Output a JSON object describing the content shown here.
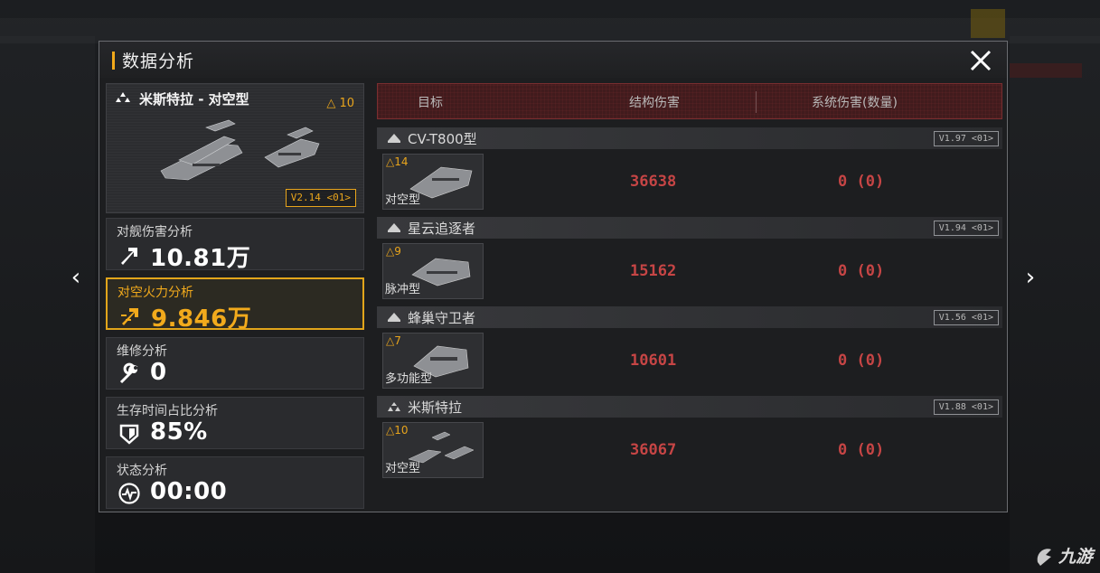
{
  "dialog": {
    "title": "数据分析"
  },
  "ship": {
    "name": "米斯特拉 - 对空型",
    "level": "△ 10",
    "version": "V2.14 <01>"
  },
  "stats": [
    {
      "label": "对舰伤害分析",
      "value": "10.81万",
      "icon": "arrow-up-right-icon",
      "active": false
    },
    {
      "label": "对空火力分析",
      "value": "9.846万",
      "icon": "anti-air-arrow-icon",
      "active": true
    },
    {
      "label": "维修分析",
      "value": "0",
      "icon": "wrench-icon",
      "active": false
    },
    {
      "label": "生存时间占比分析",
      "value": "85%",
      "icon": "shield-icon",
      "active": false
    },
    {
      "label": "状态分析",
      "value": "00:00",
      "icon": "pulse-icon",
      "active": false
    }
  ],
  "table": {
    "headers": [
      "目标",
      "结构伤害",
      "系统伤害(数量)"
    ],
    "rows": [
      {
        "name": "CV-T800型",
        "version": "V1.97 <01>",
        "level": "△14",
        "type": "对空型",
        "structural": "36638",
        "system": "0 (0)"
      },
      {
        "name": "星云追逐者",
        "version": "V1.94 <01>",
        "level": "△9",
        "type": "脉冲型",
        "structural": "15162",
        "system": "0 (0)"
      },
      {
        "name": "蜂巢守卫者",
        "version": "V1.56 <01>",
        "level": "△7",
        "type": "多功能型",
        "structural": "10601",
        "system": "0 (0)"
      },
      {
        "name": "米斯特拉",
        "version": "V1.88 <01>",
        "level": "△10",
        "type": "对空型",
        "structural": "36067",
        "system": "0 (0)"
      }
    ]
  },
  "nav": {
    "prev": "‹",
    "next": "›"
  },
  "watermark": {
    "text": "九游"
  },
  "colors": {
    "accent": "#e9a51c",
    "damage": "#c64545",
    "header_red": "#411b1d"
  }
}
